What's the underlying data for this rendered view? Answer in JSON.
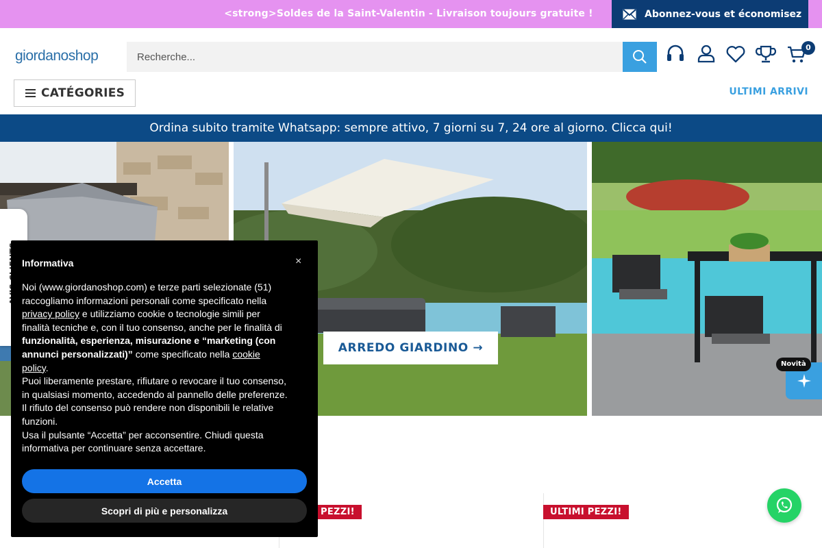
{
  "announcement": {
    "text": "<strong>Soldes de la Saint-Valentin - Livraison toujours gratuite !</strong>",
    "cta": "Abonnez-vous et économisez"
  },
  "header": {
    "logo": "giordanoshop",
    "search_placeholder": "Recherche...",
    "cart_count": "0",
    "categories_label": "CATÉGORIES",
    "ultimi_arrivi": "ULTIMI ARRIVI"
  },
  "whatsapp_bar": "Ordina subito tramite Whatsapp: sempre attivo, 7 giorni su 7, 24 ore al giorno. Clicca qui!",
  "hero": {
    "cta": "ARREDO GIARDINO →"
  },
  "side_tab": "AVIS CLIENTS",
  "cookie": {
    "title": "Informativa",
    "close": "×",
    "p1_a": "Noi (www.giordanoshop.com) e terze parti selezionate (51) raccogliamo informazioni personali come specificato nella ",
    "p1_link": "privacy policy",
    "p1_b": " e utilizziamo cookie o tecnologie simili per finalità tecniche e, con il tuo consenso, anche per le finalità di ",
    "p1_bold": "funzionalità, esperienza, misurazione e “marketing (con annunci personalizzati)”",
    "p1_c": " come specificato nella ",
    "p1_link2": "cookie policy",
    "p1_d": ".",
    "p2": "Puoi liberamente prestare, rifiutare o revocare il tuo consenso, in qualsiasi momento, accedendo al pannello delle preferenze. Il rifiuto del consenso può rendere non disponibili le relative funzioni.",
    "p3": "Usa il pulsante “Accetta” per acconsentire. Chiudi questa informativa per continuare senza accettare.",
    "accept": "Accetta",
    "more": "Scopri di più e personalizza"
  },
  "products": {
    "badge_1": "PEZZI!",
    "badge_2": "ULTIMI PEZZI!"
  },
  "widgets": {
    "novita": "Novità"
  },
  "colors": {
    "announce_bg": "#e592f0",
    "brand_dark": "#0c3c74",
    "accent_blue": "#3aa0e0",
    "sale_red": "#c8102e",
    "whatsapp_green": "#25d366"
  }
}
